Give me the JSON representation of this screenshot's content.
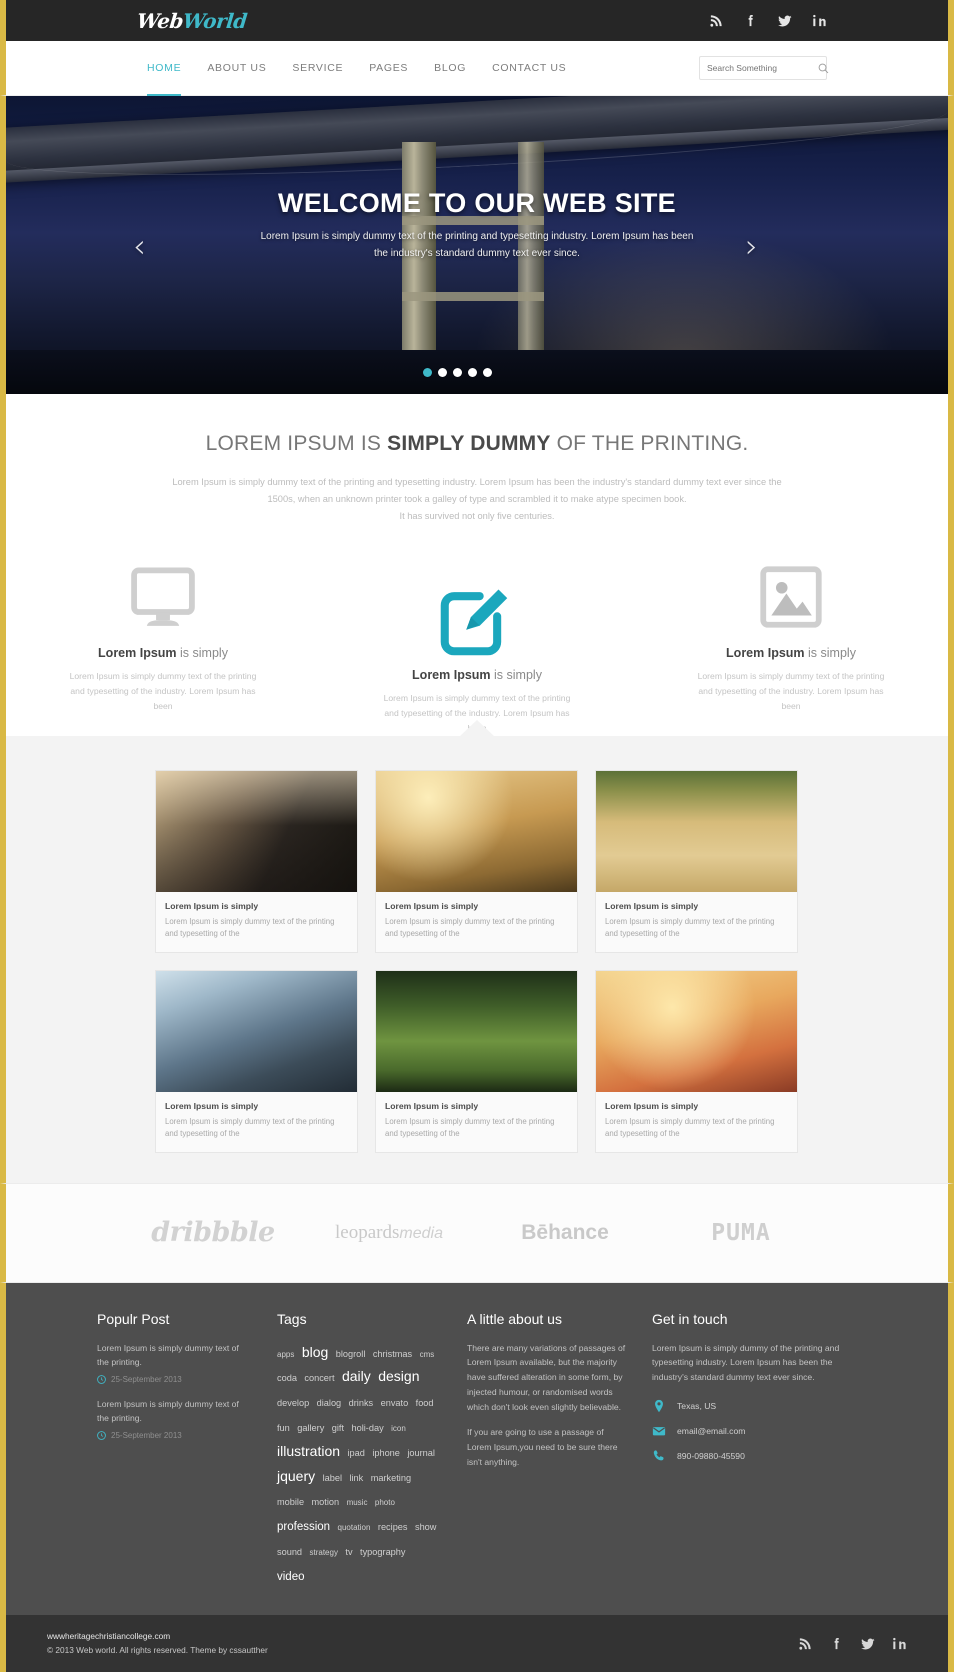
{
  "brand": {
    "name_part1": "Web",
    "name_part2": "World"
  },
  "colors": {
    "accent": "#3fb9c9",
    "dark": "#262626",
    "footer": "#4e4e4e",
    "bottom": "#333333",
    "frame": "#d9b945"
  },
  "topbar": {
    "social": [
      {
        "name": "rss-icon",
        "label": "RSS"
      },
      {
        "name": "facebook-icon",
        "label": "Facebook"
      },
      {
        "name": "twitter-icon",
        "label": "Twitter"
      },
      {
        "name": "linkedin-icon",
        "label": "LinkedIn"
      }
    ]
  },
  "nav": {
    "items": [
      {
        "label": "HOME",
        "active": true
      },
      {
        "label": "ABOUT US",
        "active": false
      },
      {
        "label": "SERVICE",
        "active": false
      },
      {
        "label": "PAGES",
        "active": false
      },
      {
        "label": "BLOG",
        "active": false
      },
      {
        "label": "CONTACT US",
        "active": false
      }
    ],
    "search": {
      "placeholder": "Search Something",
      "value": ""
    }
  },
  "hero": {
    "title": "WELCOME TO OUR WEB SITE",
    "subtitle": "Lorem Ipsum is simply dummy text of the printing and typesetting industry. Lorem Ipsum has been the industry's standard dummy text ever since.",
    "prev": "‹",
    "next": "›",
    "dots": 5,
    "active_dot": 1
  },
  "intro": {
    "heading_pre": "LOREM IPSUM IS ",
    "heading_bold": "SIMPLY DUMMY",
    "heading_post": " OF THE PRINTING.",
    "line1": "Lorem Ipsum is simply dummy text of the printing and typesetting industry. Lorem Ipsum has been the industry's standard dummy text ever since the",
    "line2": "1500s, when an unknown printer took a galley of type and scrambled it to make atype specimen book.",
    "line3": "It has survived not only five centuries."
  },
  "features": [
    {
      "icon": "monitor-icon",
      "title_bold": "Lorem Ipsum",
      "title_rest": " is simply",
      "text": "Lorem Ipsum is simply dummy text of the printing and typesetting of the industry. Lorem Ipsum has been"
    },
    {
      "icon": "pencil-edit-icon",
      "title_bold": "Lorem Ipsum",
      "title_rest": " is simply",
      "text": "Lorem Ipsum is simply dummy text of the printing and typesetting of the industry. Lorem Ipsum has been"
    },
    {
      "icon": "image-picture-icon",
      "title_bold": "Lorem Ipsum",
      "title_rest": " is simply",
      "text": "Lorem Ipsum is simply dummy text of the printing and typesetting of the industry. Lorem Ipsum has been"
    }
  ],
  "portfolio": {
    "items": [
      {
        "thumb": "vintage-car",
        "title": "Lorem Ipsum is simply",
        "text": "Lorem Ipsum is simply dummy text of the printing and typesetting of the"
      },
      {
        "thumb": "sunset-field",
        "title": "Lorem Ipsum is simply",
        "text": "Lorem Ipsum is simply dummy text of the printing and typesetting of the"
      },
      {
        "thumb": "wheat-grass",
        "title": "Lorem Ipsum is simply",
        "text": "Lorem Ipsum is simply dummy text of the printing and typesetting of the"
      },
      {
        "thumb": "glasses-blur",
        "title": "Lorem Ipsum is simply",
        "text": "Lorem Ipsum is simply dummy text of the printing and typesetting of the"
      },
      {
        "thumb": "green-wheat",
        "title": "Lorem Ipsum is simply",
        "text": "Lorem Ipsum is simply dummy text of the printing and typesetting of the"
      },
      {
        "thumb": "raspberries",
        "title": "Lorem Ipsum is simply",
        "text": "Lorem Ipsum is simply dummy text of the printing and typesetting of the"
      }
    ]
  },
  "brands": [
    {
      "name": "dribbble-logo",
      "label": "dribbble"
    },
    {
      "name": "leopards-media-logo",
      "label": "leopards",
      "label2": "media"
    },
    {
      "name": "behance-logo",
      "label": "Bēhance"
    },
    {
      "name": "puma-logo",
      "label": "PUMA"
    }
  ],
  "footer": {
    "popular": {
      "heading": "Populr Post",
      "posts": [
        {
          "text": "Lorem Ipsum is simply dummy text of the printing.",
          "date": "25-September 2013"
        },
        {
          "text": "Lorem Ipsum is simply dummy text of the printing.",
          "date": "25-September 2013"
        }
      ]
    },
    "tags": {
      "heading": "Tags",
      "items": [
        {
          "label": "apps",
          "size": 1
        },
        {
          "label": "blog",
          "size": 4
        },
        {
          "label": "blogroll",
          "size": 2
        },
        {
          "label": "christmas",
          "size": 2
        },
        {
          "label": "cms",
          "size": 1
        },
        {
          "label": "coda",
          "size": 2
        },
        {
          "label": "concert",
          "size": 2
        },
        {
          "label": "daily",
          "size": 4
        },
        {
          "label": "design",
          "size": 4
        },
        {
          "label": "develop",
          "size": 2
        },
        {
          "label": "dialog",
          "size": 2
        },
        {
          "label": "drinks",
          "size": 2
        },
        {
          "label": "envato",
          "size": 2
        },
        {
          "label": "food",
          "size": 2
        },
        {
          "label": "fun",
          "size": 2
        },
        {
          "label": "gallery",
          "size": 2
        },
        {
          "label": "gift",
          "size": 2
        },
        {
          "label": "holi-day",
          "size": 2
        },
        {
          "label": "icon",
          "size": 1
        },
        {
          "label": "illustration",
          "size": 4
        },
        {
          "label": "ipad",
          "size": 2
        },
        {
          "label": "iphone",
          "size": 2
        },
        {
          "label": "journal",
          "size": 2
        },
        {
          "label": "jquery",
          "size": 4
        },
        {
          "label": "label",
          "size": 2
        },
        {
          "label": "link",
          "size": 2
        },
        {
          "label": "marketing",
          "size": 2
        },
        {
          "label": "mobile",
          "size": 2
        },
        {
          "label": "motion",
          "size": 2
        },
        {
          "label": "music",
          "size": 1
        },
        {
          "label": "photo",
          "size": 1
        },
        {
          "label": "profession",
          "size": 3
        },
        {
          "label": "quotation",
          "size": 1
        },
        {
          "label": "recipes",
          "size": 2
        },
        {
          "label": "show",
          "size": 2
        },
        {
          "label": "sound",
          "size": 2
        },
        {
          "label": "strategy",
          "size": 1
        },
        {
          "label": "tv",
          "size": 2
        },
        {
          "label": "typography",
          "size": 2
        },
        {
          "label": "video",
          "size": 3
        }
      ]
    },
    "about": {
      "heading": "A little about us",
      "p1": "There are many variations of passages of Lorem Ipsum available, but the majority have suffered alteration in some form, by injected humour, or randomised words which don't look even slightly believable.",
      "p2": "If you are going to use a passage of Lorem Ipsum,you need to be sure there isn't anything."
    },
    "contact": {
      "heading": "Get in touch",
      "text": "Lorem Ipsum is simply dummy of the printing and typesetting industry. Lorem Ipsum has been the industry's standard dummy text ever since.",
      "lines": [
        {
          "icon": "location-pin-icon",
          "value": "Texas, US"
        },
        {
          "icon": "envelope-icon",
          "value": "email@email.com"
        },
        {
          "icon": "phone-icon",
          "value": "890-09880-45590"
        }
      ]
    }
  },
  "bottom": {
    "site": "wwwheritagechristiancollege.com",
    "copyright": "© 2013 Web world. All rights reserved. Theme by cssautther",
    "social": [
      {
        "name": "rss-icon",
        "label": "RSS"
      },
      {
        "name": "facebook-icon",
        "label": "Facebook"
      },
      {
        "name": "twitter-icon",
        "label": "Twitter"
      },
      {
        "name": "linkedin-icon",
        "label": "LinkedIn"
      }
    ]
  }
}
